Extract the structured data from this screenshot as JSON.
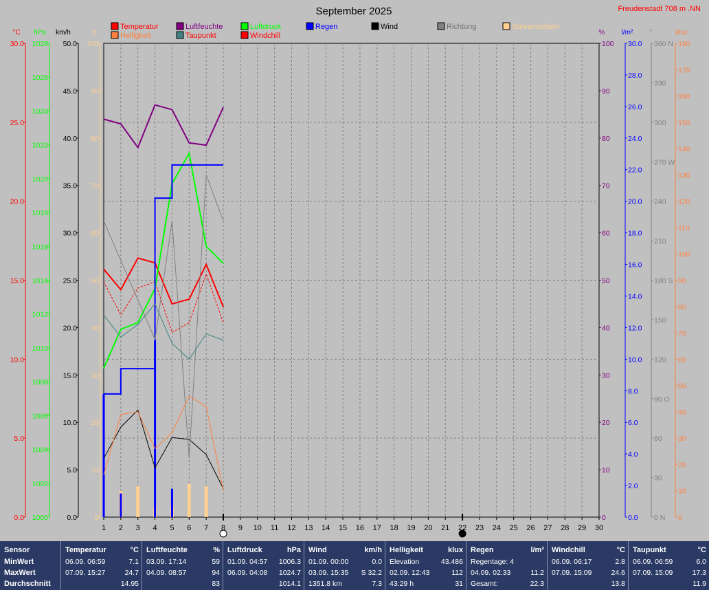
{
  "title": "September 2025",
  "station": "Freudenstadt 708 m  .NN",
  "legend": [
    {
      "label": "Temperatur",
      "color": "#ff0000",
      "text_color": "#ff0000"
    },
    {
      "label": "Luftfeuchte",
      "color": "#800080",
      "text_color": "#800080"
    },
    {
      "label": "Luftdruck",
      "color": "#00ff00",
      "text_color": "#00ff00"
    },
    {
      "label": "Regen",
      "color": "#0000ff",
      "text_color": "#0000ff"
    },
    {
      "label": "Wind",
      "color": "#000000",
      "text_color": "#000000"
    },
    {
      "label": "Richtung",
      "color": "#808080",
      "text_color": "#707070"
    },
    {
      "label": "Sonnenschein",
      "color": "#ffd090",
      "text_color": "#ffd090"
    },
    {
      "label": "Helligkeit",
      "color": "#ff8040",
      "text_color": "#ff8040"
    },
    {
      "label": "Taupunkt",
      "color": "#408080",
      "text_color": "#ff0000"
    },
    {
      "label": "Windchill",
      "color": "#ff0000",
      "text_color": "#ff0000"
    }
  ],
  "chart_data": {
    "type": "line",
    "x": [
      1,
      2,
      3,
      4,
      5,
      6,
      7,
      8
    ],
    "xlim": [
      1,
      30
    ],
    "x_ticks": [
      1,
      2,
      3,
      4,
      5,
      6,
      7,
      8,
      9,
      10,
      11,
      12,
      13,
      14,
      15,
      16,
      17,
      18,
      19,
      20,
      21,
      22,
      23,
      24,
      25,
      26,
      27,
      28,
      29,
      30
    ],
    "axes": [
      {
        "unit": "°C",
        "color": "#ff0000",
        "min": 0,
        "max": 30,
        "ticks": [
          "0.0",
          "5.0",
          "10.0",
          "15.0",
          "20.0",
          "25.0",
          "30.0"
        ]
      },
      {
        "unit": "hPa",
        "color": "#00ff00",
        "min": 1000,
        "max": 1028,
        "ticks": [
          "1000",
          "1002",
          "1004",
          "1006",
          "1008",
          "1010",
          "1012",
          "1014",
          "1016",
          "1018",
          "1020",
          "1022",
          "1024",
          "1026",
          "1028"
        ]
      },
      {
        "unit": "km/h",
        "color": "#000000",
        "min": 0,
        "max": 50,
        "ticks": [
          "0.0",
          "5.0",
          "10.0",
          "15.0",
          "20.0",
          "25.0",
          "30.0",
          "35.0",
          "40.0",
          "45.0",
          "50.0"
        ]
      },
      {
        "unit": "h",
        "color": "#ffd090",
        "min": 0,
        "max": 100,
        "ticks": [
          "0",
          "10",
          "20",
          "30",
          "40",
          "50",
          "60",
          "70",
          "80",
          "90",
          "100"
        ]
      },
      {
        "unit": "%",
        "color": "#800080",
        "min": 0,
        "max": 100,
        "ticks": [
          "0",
          "10",
          "20",
          "30",
          "40",
          "50",
          "60",
          "70",
          "80",
          "90",
          "100"
        ]
      },
      {
        "unit": "l/m²",
        "color": "#0000ff",
        "min": 0,
        "max": 30,
        "ticks": [
          "0.0",
          "2.0",
          "4.0",
          "6.0",
          "8.0",
          "10.0",
          "12.0",
          "14.0",
          "16.0",
          "18.0",
          "20.0",
          "22.0",
          "24.0",
          "26.0",
          "28.0",
          "30.0"
        ]
      },
      {
        "unit": "°",
        "color": "#808080",
        "min": 0,
        "max": 360,
        "ticks": [
          "0  N",
          "30",
          "60",
          "90  O",
          "120",
          "150",
          "180 S",
          "210",
          "240",
          "270 W",
          "300",
          "330",
          "360 N"
        ]
      },
      {
        "unit": "klux",
        "color": "#ff8040",
        "min": 0,
        "max": 180,
        "ticks": [
          "0",
          "10",
          "20",
          "30",
          "40",
          "50",
          "60",
          "70",
          "80",
          "90",
          "100",
          "110",
          "120",
          "130",
          "140",
          "150",
          "160",
          "170",
          "180"
        ]
      }
    ],
    "series": [
      {
        "name": "Temperatur",
        "axis": 0,
        "color": "#ff0000",
        "width": 2,
        "values": [
          15.7,
          14.4,
          16.4,
          16.1,
          13.5,
          13.8,
          16.0,
          13.3
        ]
      },
      {
        "name": "Windchill",
        "axis": 0,
        "color": "#ff0000",
        "width": 1,
        "dash": true,
        "values": [
          14.9,
          12.8,
          14.5,
          14.9,
          11.7,
          12.3,
          15.4,
          12.3
        ]
      },
      {
        "name": "Luftfeuchte",
        "axis": 4,
        "color": "#800080",
        "width": 2,
        "values": [
          84,
          83,
          78,
          87,
          86,
          79,
          78.5,
          86.5
        ]
      },
      {
        "name": "Luftdruck",
        "axis": 1,
        "color": "#00ff00",
        "width": 2,
        "values": [
          1008.8,
          1011.1,
          1011.5,
          1013.5,
          1019.7,
          1021.5,
          1016.0,
          1015.0
        ]
      },
      {
        "name": "Regen",
        "axis": 5,
        "color": "#0000ff",
        "width": 2,
        "step": true,
        "values": [
          7.8,
          9.4,
          9.4,
          20.2,
          22.3,
          22.3,
          22.3,
          22.3
        ]
      },
      {
        "name": "Wind",
        "axis": 2,
        "color": "#000000",
        "width": 1,
        "values": [
          6.2,
          9.5,
          11.3,
          5.2,
          8.4,
          8.2,
          6.6,
          3.0
        ]
      },
      {
        "name": "Richtung",
        "axis": 6,
        "color": "#808080",
        "width": 1,
        "values": [
          225,
          195,
          165,
          135,
          225,
          45,
          260,
          225
        ]
      },
      {
        "name": "Taupunkt",
        "axis": 0,
        "color": "#408080",
        "width": 1,
        "values": [
          12.8,
          11.4,
          12.2,
          13.5,
          11.0,
          10.0,
          11.6,
          11.2
        ]
      },
      {
        "name": "Helligkeit",
        "axis": 7,
        "color": "#ff8040",
        "width": 1,
        "values": [
          16,
          39,
          40,
          26,
          32,
          46,
          42,
          10
        ]
      }
    ],
    "bars": [
      {
        "name": "Sonnenschein",
        "axis": 3,
        "color": "#ffd090",
        "x": [
          2,
          3,
          4,
          5,
          6,
          7
        ],
        "values": [
          5.5,
          6.5,
          2,
          2,
          7,
          6.5
        ]
      },
      {
        "name": "Regen",
        "axis": 5,
        "color": "#0000ff",
        "x": [
          1,
          2,
          4,
          5
        ],
        "values": [
          7.8,
          1.5,
          11.2,
          1.8
        ]
      }
    ],
    "markers": [
      {
        "x": 8,
        "type": "open-circle"
      },
      {
        "x": 22,
        "type": "filled-circle"
      }
    ]
  },
  "table": [
    {
      "header": "Sensor",
      "unit": "",
      "rows": [
        {
          "l": "MinWert",
          "r": ""
        },
        {
          "l": "MaxWert",
          "r": ""
        },
        {
          "l": "Durchschnitt",
          "r": ""
        }
      ]
    },
    {
      "header": "Temperatur",
      "unit": "°C",
      "rows": [
        {
          "l": "06.09.  06:59",
          "r": "7.1"
        },
        {
          "l": "07.09.  15:27",
          "r": "24.7"
        },
        {
          "l": "",
          "r": "14.95"
        }
      ]
    },
    {
      "header": "Luftfeuchte",
      "unit": "%",
      "rows": [
        {
          "l": "03.09.  17:14",
          "r": "59"
        },
        {
          "l": "04.09.  08:57",
          "r": "94"
        },
        {
          "l": "",
          "r": "83"
        }
      ]
    },
    {
      "header": "Luftdruck",
      "unit": "hPa",
      "rows": [
        {
          "l": "01.09.  04:57",
          "r": "1006.3"
        },
        {
          "l": "06.09.  04:08",
          "r": "1024.7"
        },
        {
          "l": "",
          "r": "1014.1"
        }
      ]
    },
    {
      "header": "Wind",
      "unit": "km/h",
      "rows": [
        {
          "l": "01.09.  00:00",
          "r": "0.0"
        },
        {
          "l": "03.09.  15:35",
          "r": "S 32.2"
        },
        {
          "l": "1351.8 km",
          "r": "7.3"
        }
      ]
    },
    {
      "header": "Helligkeit",
      "unit": "klux",
      "rows": [
        {
          "l": "Elevation",
          "r": "43.486"
        },
        {
          "l": "02.09.  12:43",
          "r": "112"
        },
        {
          "l": "43:29 h",
          "r": "31"
        }
      ]
    },
    {
      "header": "Regen",
      "unit": "l/m²",
      "rows": [
        {
          "l": "Regentage: 4",
          "r": ""
        },
        {
          "l": "04.09.  02:33",
          "r": "11.2"
        },
        {
          "l": "Gesamt:",
          "r": "22.3"
        }
      ]
    },
    {
      "header": "Windchill",
      "unit": "°C",
      "rows": [
        {
          "l": "06.09.  06:17",
          "r": "2.8"
        },
        {
          "l": "07.09.  15:09",
          "r": "24.6"
        },
        {
          "l": "",
          "r": "13.8"
        }
      ]
    },
    {
      "header": "Taupunkt",
      "unit": "°C",
      "rows": [
        {
          "l": "06.09.  06:59",
          "r": "6.0"
        },
        {
          "l": "07.09.  15:09",
          "r": "17.3"
        },
        {
          "l": "",
          "r": "11.9"
        }
      ]
    }
  ]
}
